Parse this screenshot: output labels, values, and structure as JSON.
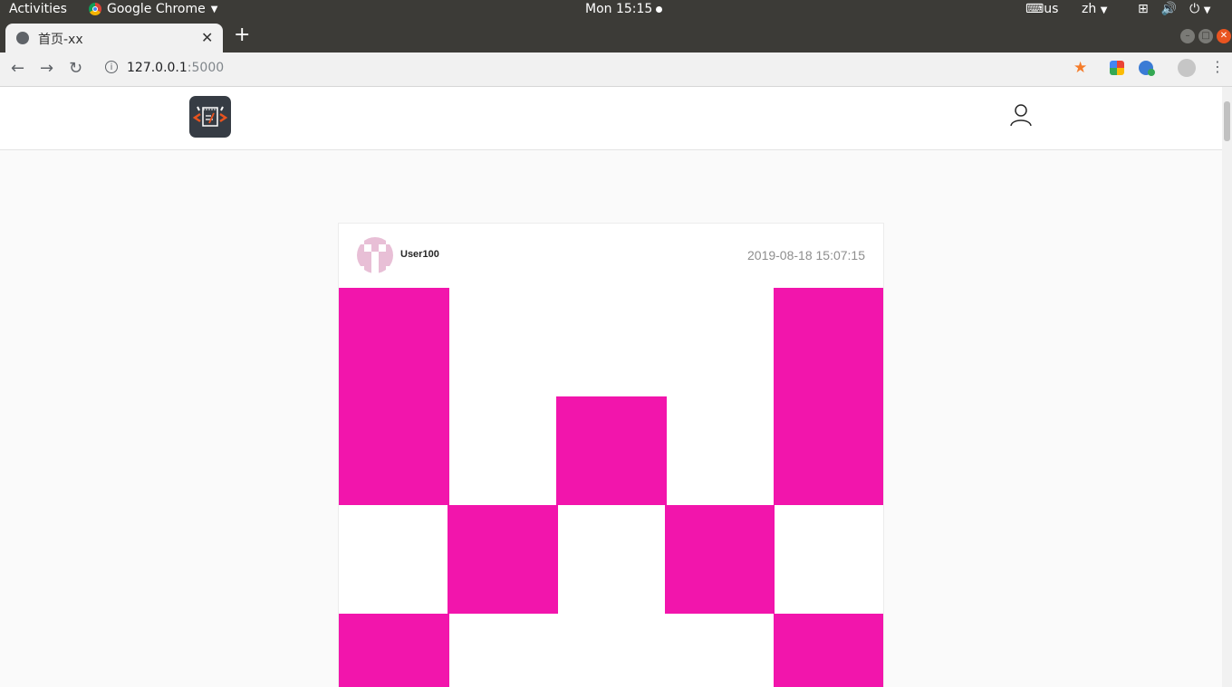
{
  "os": {
    "activities": "Activities",
    "app_name": "Google Chrome",
    "clock": "Mon 15:15",
    "keyboard": "us",
    "language": "zh"
  },
  "browser": {
    "tab_title": "首页-xx",
    "url_host": "127.0.0.1",
    "url_port": ":5000"
  },
  "post": {
    "username": "User100",
    "timestamp": "2019-08-18 15:07:15",
    "identicon_color": "#f215ac"
  },
  "colors": {
    "accent": "#f215ac",
    "logo_bg": "#363c44",
    "logo_accent": "#e8531f"
  }
}
